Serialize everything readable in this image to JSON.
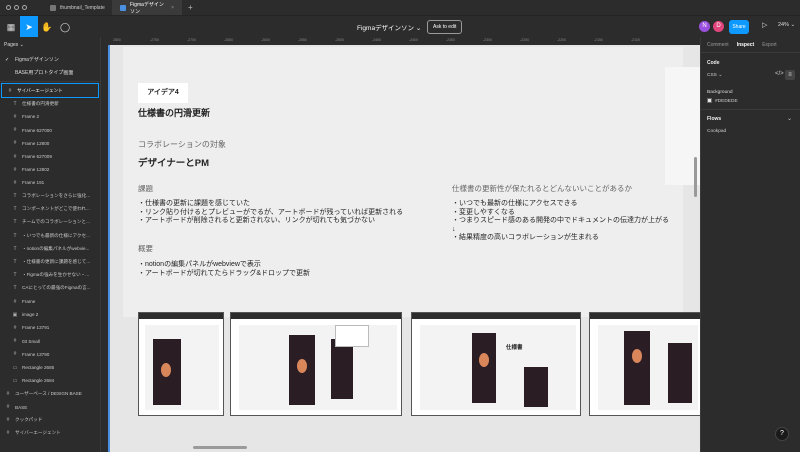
{
  "tabs": [
    {
      "label": "thumbnail_Template"
    },
    {
      "label": "Figmaデザインソン"
    }
  ],
  "toolbar": {
    "file_title": "Figmaデザインソン ⌄",
    "ask_to_edit": "Ask to edit",
    "avatar1": "N",
    "avatar2": "D",
    "share": "Share",
    "zoom": "24% ⌄"
  },
  "sidebar": {
    "pages_label": "Pages ⌄",
    "pages": [
      {
        "label": "Figmaデザインソン"
      },
      {
        "label": "BASE用プロトタイプ画面"
      }
    ],
    "layers": [
      {
        "label": "サイバーエージェント",
        "icon": "#"
      },
      {
        "label": "仕様書の円滑更新",
        "icon": "T"
      },
      {
        "label": "Frame 2",
        "icon": "#"
      },
      {
        "label": "Frame 627000",
        "icon": "#"
      },
      {
        "label": "Frame 12800",
        "icon": "#"
      },
      {
        "label": "Frame 627009",
        "icon": "#"
      },
      {
        "label": "Frame 12802",
        "icon": "#"
      },
      {
        "label": "Frame 191",
        "icon": "#"
      },
      {
        "label": "コラボレーションをさらに強化...",
        "icon": "T"
      },
      {
        "label": "コンポーネントがどこで使われ...",
        "icon": "T"
      },
      {
        "label": "チームでのコラボレーションと...",
        "icon": "T"
      },
      {
        "label": "・いつでも最新の仕様にアクセ...",
        "icon": "T"
      },
      {
        "label": "・notionの編集パネルがwebvie...",
        "icon": "T"
      },
      {
        "label": "・仕様書の更新に課題を感じて...",
        "icon": "T"
      },
      {
        "label": "・Figmaの強みを生かせない・...",
        "icon": "T"
      },
      {
        "label": "CAにとっての最強のFigmaの言...",
        "icon": "T"
      },
      {
        "label": "Frame",
        "icon": "#"
      },
      {
        "label": "image 2",
        "icon": "▣"
      },
      {
        "label": "Frame 13791",
        "icon": "#"
      },
      {
        "label": "03 Small",
        "icon": "#"
      },
      {
        "label": "Frame 13790",
        "icon": "#"
      },
      {
        "label": "Rectangle 2685",
        "icon": "▭"
      },
      {
        "label": "Rectangle 2684",
        "icon": "▭"
      },
      {
        "label": "ユーザーペース / DESIGN BASE",
        "icon": "#"
      },
      {
        "label": "BASE",
        "icon": "#"
      },
      {
        "label": "クックパッド",
        "icon": "#"
      },
      {
        "label": "サイバーエージェント",
        "icon": "#"
      }
    ]
  },
  "ruler": [
    "2800",
    "-2750",
    "-2700",
    "-2650",
    "-2600",
    "-2550",
    "-2500",
    "-2450",
    "-2400",
    "-2350",
    "-2300",
    "-2250",
    "-2200",
    "-2150",
    "-2100"
  ],
  "canvas": {
    "idea_tag": "アイデア4",
    "title": "仕様書の円滑更新",
    "collab_label": "コラボレーションの対象",
    "collab_value": "デザイナーとPM",
    "issue_label": "課題",
    "issue_lines": [
      "・仕様書の更新に課題を感じていた",
      "・リンク貼り付けるとプレビューがでるが、アートボードが残っていれば更新される",
      "・アートボードが削除されると更新されない、リンクが切れても気づかない"
    ],
    "summary_label": "概要",
    "summary_lines": [
      "・notionの編集パネルがwebviewで表示",
      "・アートボードが切れてたらドラッグ&ドロップで更新"
    ],
    "effect_label": "仕様書の更新性が保たれるとどんないいことがあるか",
    "effect_lines": [
      "・いつでも最新の仕様にアクセスできる",
      "・変更しやすくなる",
      "・つまりスピード感のある開発の中でドキュメントの伝達力が上がる",
      "↓",
      "・結果精度の高いコラボレーションが生まれる"
    ],
    "shot_caption": "仕様書"
  },
  "right_panel": {
    "tabs": [
      "Comment",
      "Inspect",
      "Export"
    ],
    "code_label": "Code",
    "css_label": "CSS ⌄",
    "background_label": "Background",
    "background_value": "#DEDEDE",
    "flows_label": "Flows",
    "flow_item": "Cookpad"
  },
  "colors": {
    "accent": "#0d99ff",
    "canvas_bg": "#e6e6e6"
  }
}
